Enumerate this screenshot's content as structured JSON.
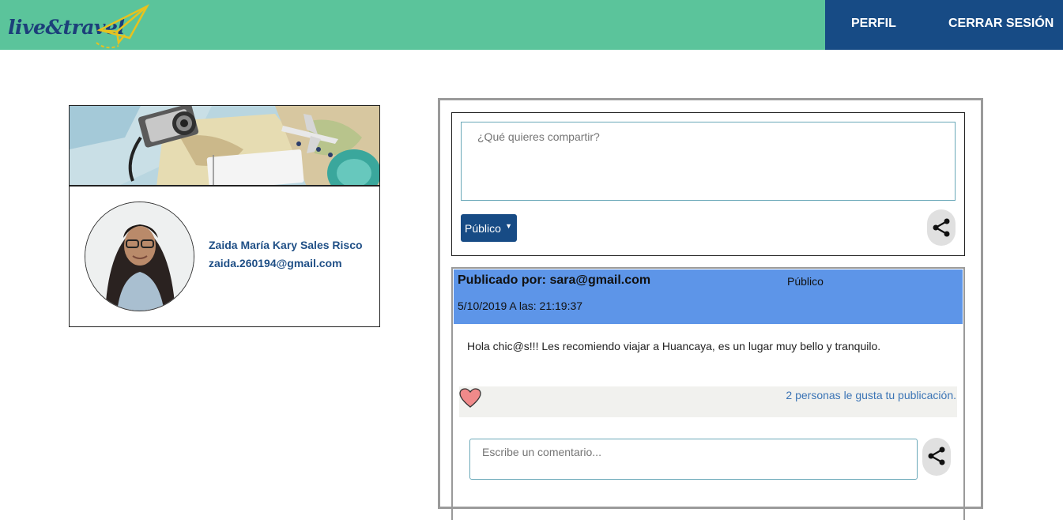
{
  "header": {
    "logo_text": "live&travel",
    "nav": {
      "profile_label": "PERFIL",
      "logout_label": "CERRAR SESIÓN"
    }
  },
  "profile": {
    "name": "Zaida María Kary Sales Risco",
    "email": "zaida.260194@gmail.com"
  },
  "composer": {
    "placeholder": "¿Qué quieres compartir?",
    "privacy_selected": "Público",
    "share_icon": "share-icon"
  },
  "posts": [
    {
      "author_line": "Publicado por: sara@gmail.com",
      "privacy": "Público",
      "date_line": "5/10/2019 A las: 21:19:37",
      "body": "Hola chic@s!!! Les recomiendo viajar a Huancaya, es un lugar muy bello y tranquilo.",
      "likes_text": "2 personas le gusta tu publicación.",
      "comment_placeholder": "Escribe un comentario..."
    }
  ],
  "colors": {
    "header_bg": "#5bc49b",
    "nav_bg": "#174b85",
    "post_header_bg": "#5d95e8",
    "link_text": "#3b74b5"
  }
}
